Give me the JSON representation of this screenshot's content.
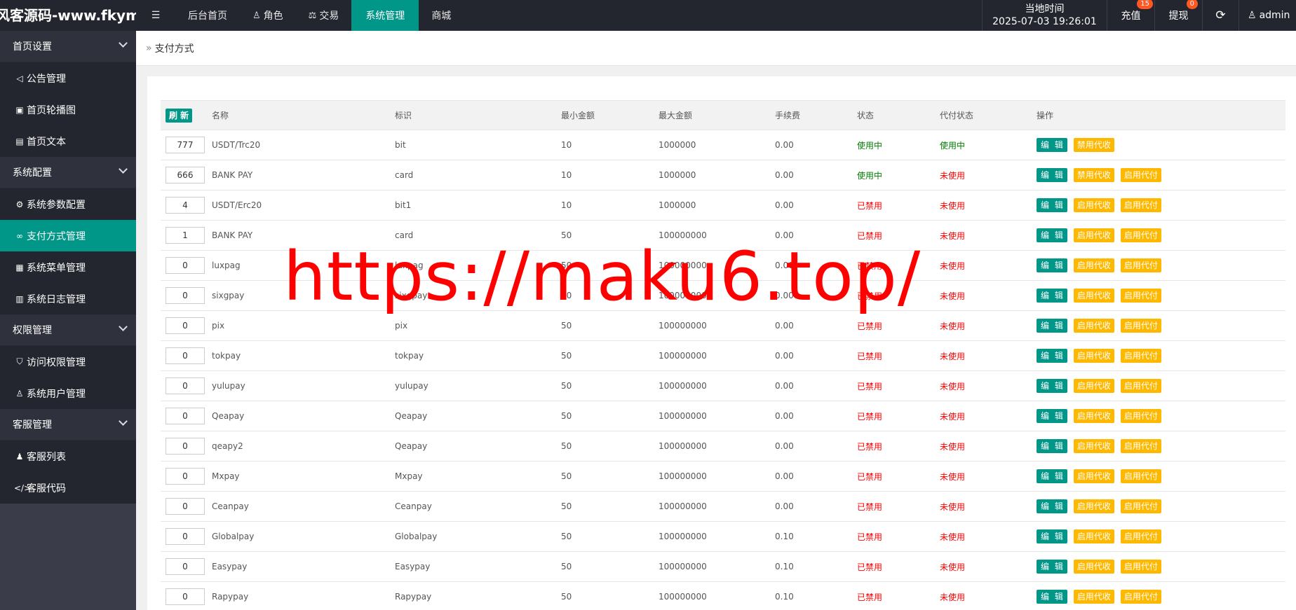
{
  "header": {
    "logo": "风客源码-www.fkym.n...",
    "nav": [
      {
        "label": "后台首页"
      },
      {
        "label": "角色"
      },
      {
        "label": "交易"
      },
      {
        "label": "系统管理"
      },
      {
        "label": "商城"
      }
    ],
    "time_label": "当地时间",
    "time_value": "2025-07-03 19:26:01",
    "recharge_label": "充值",
    "recharge_badge": "15",
    "withdraw_label": "提现",
    "withdraw_badge": "0",
    "admin_label": "admin"
  },
  "sidebar": {
    "groups": [
      {
        "title": "首页设置",
        "items": [
          "公告管理",
          "首页轮播图",
          "首页文本"
        ]
      },
      {
        "title": "系统配置",
        "items": [
          "系统参数配置",
          "支付方式管理",
          "系统菜单管理",
          "系统日志管理"
        ]
      },
      {
        "title": "权限管理",
        "items": [
          "访问权限管理",
          "系统用户管理"
        ]
      },
      {
        "title": "客服管理",
        "items": [
          "客服列表",
          "客服代码"
        ]
      }
    ]
  },
  "breadcrumb": "支付方式",
  "table": {
    "refresh_label": "刷 新",
    "headers": [
      "名称",
      "标识",
      "最小金额",
      "最大金额",
      "手续费",
      "状态",
      "代付状态",
      "操作"
    ],
    "edit_label": "编 辑",
    "rows": [
      {
        "sort": "777",
        "name": "USDT/Trc20",
        "code": "bit",
        "min": "10",
        "max": "1000000",
        "fee": "0.00",
        "status": "使用中",
        "payout": "使用中",
        "actions": [
          "编 辑",
          "禁用代收"
        ]
      },
      {
        "sort": "666",
        "name": "BANK PAY",
        "code": "card",
        "min": "10",
        "max": "1000000",
        "fee": "0.00",
        "status": "使用中",
        "payout": "未使用",
        "actions": [
          "编 辑",
          "禁用代收",
          "启用代付"
        ]
      },
      {
        "sort": "4",
        "name": "USDT/Erc20",
        "code": "bit1",
        "min": "10",
        "max": "1000000",
        "fee": "0.00",
        "status": "已禁用",
        "payout": "未使用",
        "actions": [
          "编 辑",
          "启用代收",
          "启用代付"
        ]
      },
      {
        "sort": "1",
        "name": "BANK PAY",
        "code": "card",
        "min": "50",
        "max": "100000000",
        "fee": "0.00",
        "status": "已禁用",
        "payout": "未使用",
        "actions": [
          "编 辑",
          "启用代收",
          "启用代付"
        ]
      },
      {
        "sort": "0",
        "name": "luxpag",
        "code": "luxpag",
        "min": "50",
        "max": "100000000",
        "fee": "0.00",
        "status": "已禁用",
        "payout": "未使用",
        "actions": [
          "编 辑",
          "启用代收",
          "启用代付"
        ]
      },
      {
        "sort": "0",
        "name": "sixgpay",
        "code": "sixgpay",
        "min": "50",
        "max": "100000000",
        "fee": "0.00",
        "status": "已禁用",
        "payout": "未使用",
        "actions": [
          "编 辑",
          "启用代收",
          "启用代付"
        ]
      },
      {
        "sort": "0",
        "name": "pix",
        "code": "pix",
        "min": "50",
        "max": "100000000",
        "fee": "0.00",
        "status": "已禁用",
        "payout": "未使用",
        "actions": [
          "编 辑",
          "启用代收",
          "启用代付"
        ]
      },
      {
        "sort": "0",
        "name": "tokpay",
        "code": "tokpay",
        "min": "50",
        "max": "100000000",
        "fee": "0.00",
        "status": "已禁用",
        "payout": "未使用",
        "actions": [
          "编 辑",
          "启用代收",
          "启用代付"
        ]
      },
      {
        "sort": "0",
        "name": "yulupay",
        "code": "yulupay",
        "min": "50",
        "max": "100000000",
        "fee": "0.00",
        "status": "已禁用",
        "payout": "未使用",
        "actions": [
          "编 辑",
          "启用代收",
          "启用代付"
        ]
      },
      {
        "sort": "0",
        "name": "Qeapay",
        "code": "Qeapay",
        "min": "50",
        "max": "100000000",
        "fee": "0.00",
        "status": "已禁用",
        "payout": "未使用",
        "actions": [
          "编 辑",
          "启用代收",
          "启用代付"
        ]
      },
      {
        "sort": "0",
        "name": "qeapy2",
        "code": "Qeapay",
        "min": "50",
        "max": "100000000",
        "fee": "0.00",
        "status": "已禁用",
        "payout": "未使用",
        "actions": [
          "编 辑",
          "启用代收",
          "启用代付"
        ]
      },
      {
        "sort": "0",
        "name": "Mxpay",
        "code": "Mxpay",
        "min": "50",
        "max": "100000000",
        "fee": "0.00",
        "status": "已禁用",
        "payout": "未使用",
        "actions": [
          "编 辑",
          "启用代收",
          "启用代付"
        ]
      },
      {
        "sort": "0",
        "name": "Ceanpay",
        "code": "Ceanpay",
        "min": "50",
        "max": "100000000",
        "fee": "0.00",
        "status": "已禁用",
        "payout": "未使用",
        "actions": [
          "编 辑",
          "启用代收",
          "启用代付"
        ]
      },
      {
        "sort": "0",
        "name": "Globalpay",
        "code": "Globalpay",
        "min": "50",
        "max": "100000000",
        "fee": "0.10",
        "status": "已禁用",
        "payout": "未使用",
        "actions": [
          "编 辑",
          "启用代收",
          "启用代付"
        ]
      },
      {
        "sort": "0",
        "name": "Easypay",
        "code": "Easypay",
        "min": "50",
        "max": "100000000",
        "fee": "0.10",
        "status": "已禁用",
        "payout": "未使用",
        "actions": [
          "编 辑",
          "启用代收",
          "启用代付"
        ]
      },
      {
        "sort": "0",
        "name": "Rapypay",
        "code": "Rapypay",
        "min": "50",
        "max": "100000000",
        "fee": "0.10",
        "status": "已禁用",
        "payout": "未使用",
        "actions": [
          "编 辑",
          "启用代收",
          "启用代付"
        ]
      }
    ]
  },
  "watermark": "https://maku6.top/",
  "colors": {
    "primary": "#009688",
    "warning": "#ffb800",
    "active_status": "#008000",
    "disabled_status": "#ff0000",
    "topbar": "#23262e"
  }
}
